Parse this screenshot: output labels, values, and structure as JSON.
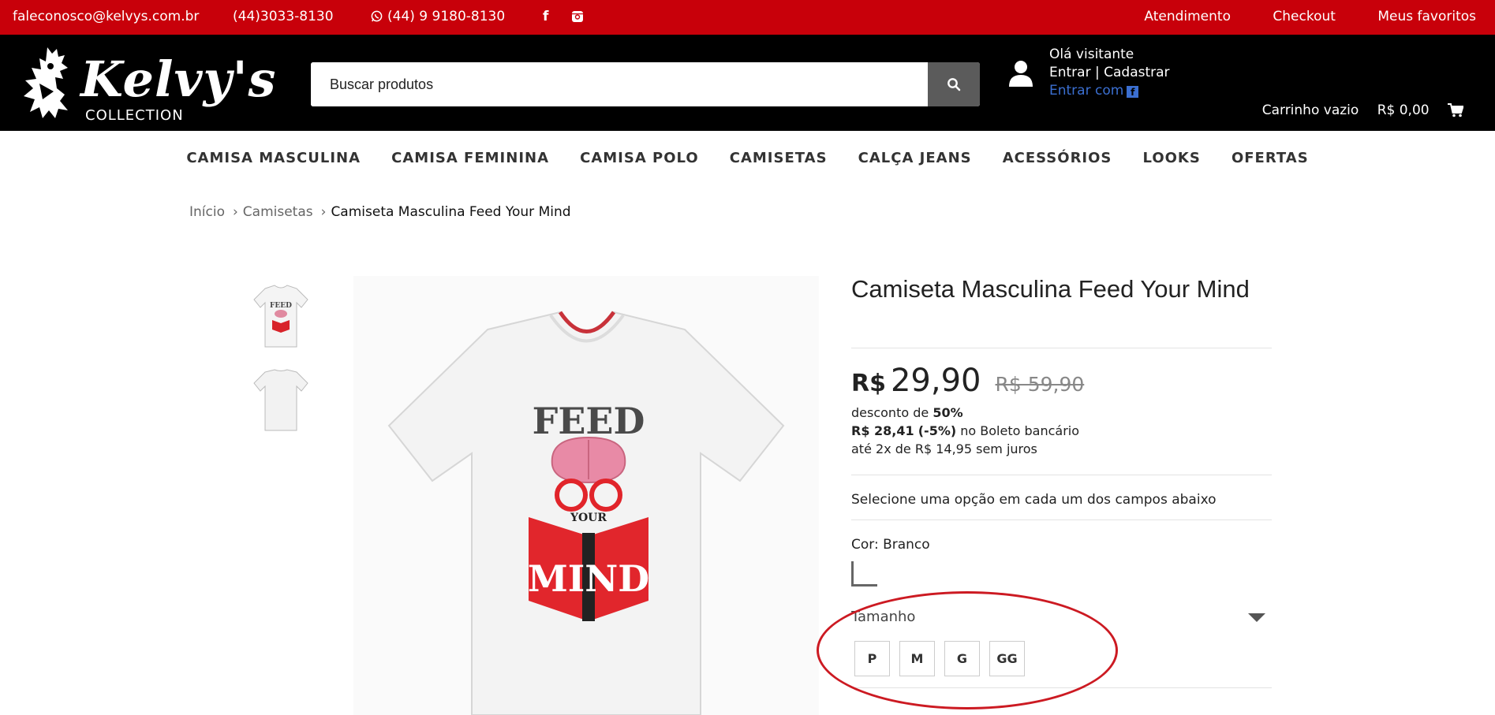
{
  "topbar": {
    "email": "faleconosco@kelvys.com.br",
    "phone": "(44)3033-8130",
    "whatsapp": "(44) 9 9180-8130",
    "facebook_glyph": "f",
    "links": [
      "Atendimento",
      "Checkout",
      "Meus favoritos"
    ]
  },
  "header": {
    "logo_script": "Kelvy's",
    "logo_sub": "COLLECTION",
    "search_placeholder": "Buscar produtos",
    "greeting": "Olá visitante",
    "login_link": "Entrar | Cadastrar",
    "facebook_login": "Entrar com",
    "cart_status": "Carrinho vazio",
    "cart_total": "R$ 0,00"
  },
  "nav": {
    "items": [
      "CAMISA MASCULINA",
      "CAMISA FEMININA",
      "CAMISA POLO",
      "CAMISETAS",
      "CALÇA JEANS",
      "ACESSÓRIOS",
      "LOOKS",
      "OFERTAS"
    ]
  },
  "breadcrumb": {
    "items": [
      "Início",
      "Camisetas",
      "Camiseta Masculina Feed Your Mind"
    ]
  },
  "product": {
    "title": "Camiseta Masculina Feed Your Mind",
    "currency": "R$",
    "price": "29,90",
    "old_price": "R$ 59,90",
    "discount_label": "desconto de",
    "discount_value": "50%",
    "boleto_price": "R$ 28,41",
    "boleto_discount": "(-5%)",
    "boleto_label": "no Boleto bancário",
    "installments": "até 2x de R$ 14,95 sem juros",
    "select_msg": "Selecione uma opção em cada um dos campos abaixo",
    "color_label": "Cor: Branco",
    "size_label": "Tamanho",
    "sizes": [
      "P",
      "M",
      "G",
      "GG"
    ],
    "print_top": "FEED",
    "print_mid": "YOUR",
    "print_bottom": "MIND"
  },
  "colors": {
    "topbar": "#c8000a",
    "header": "#000000",
    "highlight": "#cc1a22",
    "facebook": "#3b6fd1"
  }
}
